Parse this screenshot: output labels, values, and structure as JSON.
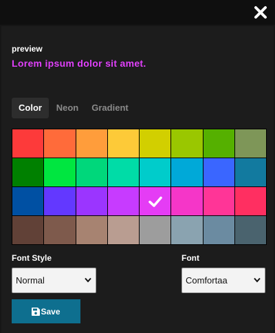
{
  "preview": {
    "label": "preview",
    "text": "Lorem ipsum dolor sit amet.",
    "text_color": "#e040fb"
  },
  "tabs": [
    {
      "label": "Color",
      "active": true
    },
    {
      "label": "Neon",
      "active": false
    },
    {
      "label": "Gradient",
      "active": false
    }
  ],
  "palette": {
    "colors": [
      "#fd3a3a",
      "#ff6b3a",
      "#ff9d3b",
      "#fdca38",
      "#d2cf00",
      "#9ac700",
      "#55b000",
      "#7e9658",
      "#008000",
      "#00e640",
      "#00d77b",
      "#00dca7",
      "#00cccb",
      "#00a9d8",
      "#3a66ff",
      "#127a9f",
      "#0050a3",
      "#6338ff",
      "#9b35ff",
      "#c73bff",
      "#e53cf5",
      "#f536c8",
      "#ff3597",
      "#ff2f61",
      "#614137",
      "#7e5a4c",
      "#a78371",
      "#b99d91",
      "#9d9d9d",
      "#8aa3b0",
      "#6b8ba1",
      "#4a636e"
    ],
    "selected_index": 20
  },
  "font_style": {
    "label": "Font Style",
    "value": "Normal"
  },
  "font": {
    "label": "Font",
    "value": "Comfortaa"
  },
  "save": {
    "label": "Save",
    "icon": "floppy-disk-icon"
  },
  "close": {
    "icon": "close-icon"
  }
}
